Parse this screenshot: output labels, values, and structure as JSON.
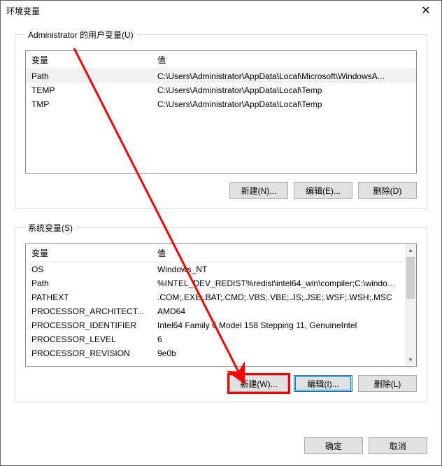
{
  "dialog": {
    "title": "环境变量",
    "close_glyph": "✕"
  },
  "user_section": {
    "legend": "Administrator 的用户变量(U)",
    "headers": {
      "var": "变量",
      "val": "值"
    },
    "rows": [
      {
        "var": "Path",
        "val": "C:\\Users\\Administrator\\AppData\\Local\\Microsoft\\WindowsA..."
      },
      {
        "var": "TEMP",
        "val": "C:\\Users\\Administrator\\AppData\\Local\\Temp"
      },
      {
        "var": "TMP",
        "val": "C:\\Users\\Administrator\\AppData\\Local\\Temp"
      }
    ],
    "buttons": {
      "new": "新建(N)...",
      "edit": "编辑(E)...",
      "del": "删除(D)"
    }
  },
  "sys_section": {
    "legend": "系统变量(S)",
    "headers": {
      "var": "变量",
      "val": "值"
    },
    "rows": [
      {
        "var": "OS",
        "val": "Windows_NT"
      },
      {
        "var": "Path",
        "val": "%INTEL_DEV_REDIST%redist\\intel64_win\\compiler;C:\\windows..."
      },
      {
        "var": "PATHEXT",
        "val": ".COM;.EXE;.BAT;.CMD;.VBS;.VBE;.JS;.JSE;.WSF;.WSH;.MSC"
      },
      {
        "var": "PROCESSOR_ARCHITECT...",
        "val": "AMD64"
      },
      {
        "var": "PROCESSOR_IDENTIFIER",
        "val": "Intel64 Family 6 Model 158 Stepping 11, GenuineIntel"
      },
      {
        "var": "PROCESSOR_LEVEL",
        "val": "6"
      },
      {
        "var": "PROCESSOR_REVISION",
        "val": "9e0b"
      }
    ],
    "buttons": {
      "new": "新建(W)...",
      "edit": "编辑(I)...",
      "del": "删除(L)"
    }
  },
  "footer": {
    "ok": "确定",
    "cancel": "取消"
  },
  "annotation": {
    "color": "#ff0000"
  }
}
